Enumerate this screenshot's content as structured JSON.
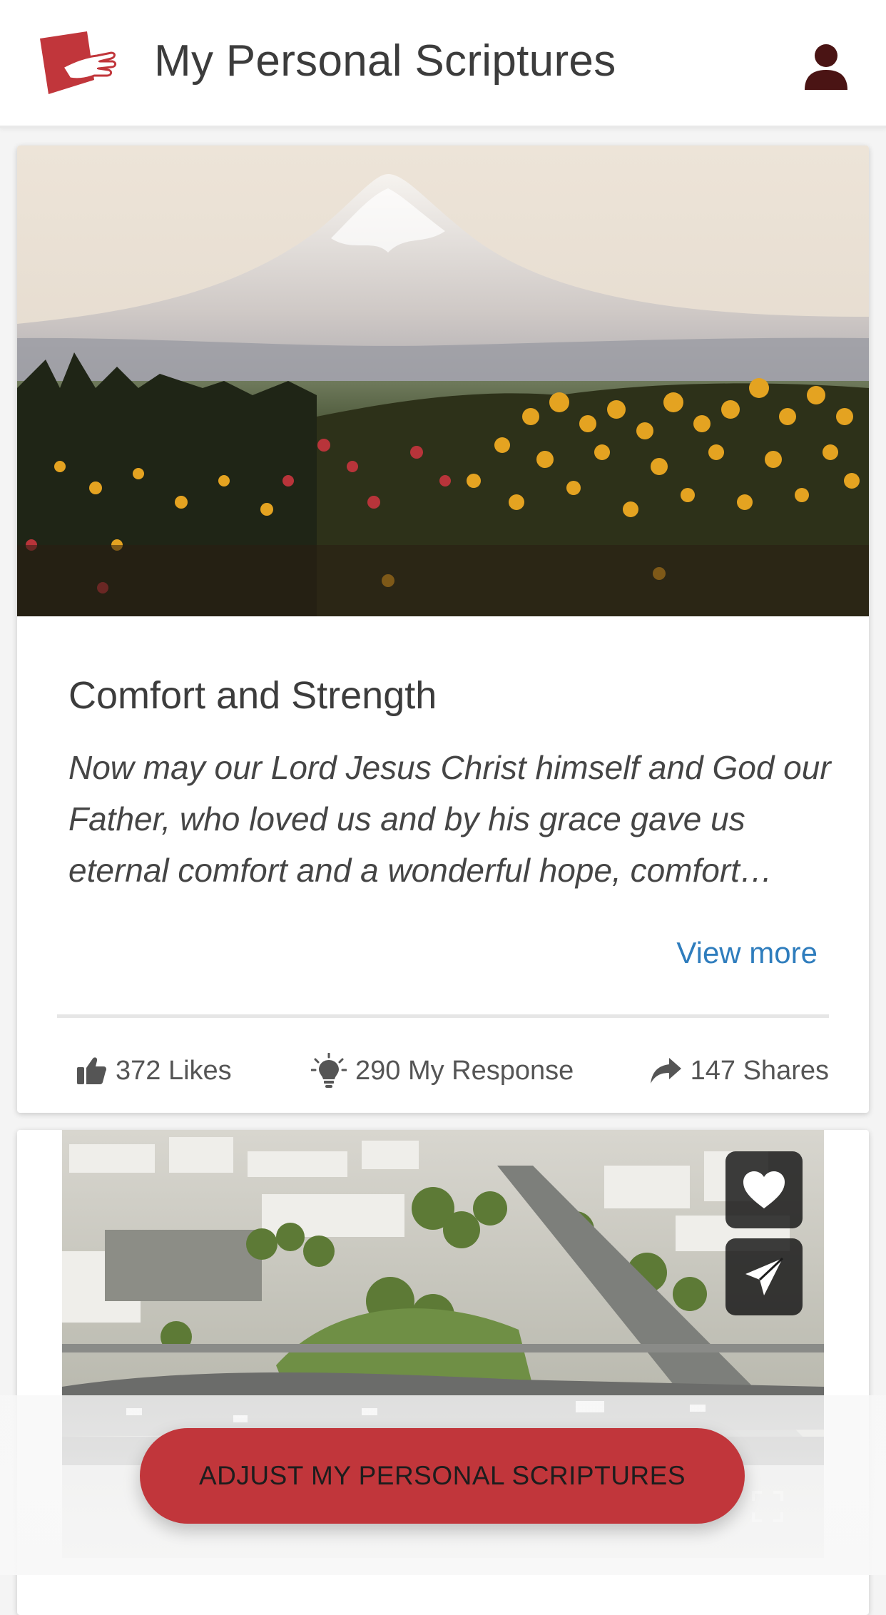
{
  "header": {
    "title": "My Personal Scriptures",
    "logo_icon": "bible-hand-logo-icon",
    "profile_icon": "user-profile-icon"
  },
  "cards": [
    {
      "title": "Comfort and Strength",
      "excerpt": "Now may our Lord Jesus Christ himself and God our Father, who loved us and by his grace gave us eternal comfort and a wonderful hope, comfort…",
      "view_more": "View more",
      "stats": {
        "likes": "372 Likes",
        "responses": "290 My Response",
        "shares": "147 Shares"
      }
    },
    {
      "overlay_icons": [
        "heart-icon",
        "send-icon"
      ]
    }
  ],
  "cta": {
    "label": "ADJUST MY PERSONAL SCRIPTURES"
  },
  "colors": {
    "brand_red": "#c1363b",
    "link_blue": "#2f7dbd",
    "profile_dark": "#4a1414"
  }
}
